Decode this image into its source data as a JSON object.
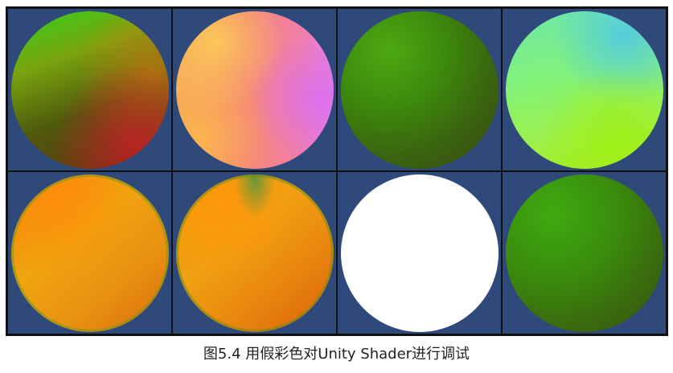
{
  "figure": {
    "caption": "图5.4 用假彩色对Unity Shader进行调试",
    "background_color": "#2f4a7a",
    "cells": [
      {
        "sphere": "false-color-sphere-1",
        "dominant_colors": [
          "#2fd21b",
          "#7aa30e",
          "#6a3010"
        ]
      },
      {
        "sphere": "false-color-sphere-2",
        "dominant_colors": [
          "#f5a55a",
          "#f5857a",
          "#e182e0"
        ]
      },
      {
        "sphere": "false-color-sphere-3",
        "dominant_colors": [
          "#4da812",
          "#3a6410"
        ]
      },
      {
        "sphere": "false-color-sphere-4",
        "dominant_colors": [
          "#6fe7a8",
          "#a8e81c",
          "#50c8e6"
        ]
      },
      {
        "sphere": "false-color-sphere-5",
        "dominant_colors": [
          "#f08a08",
          "#f0a410",
          "#d86a08"
        ]
      },
      {
        "sphere": "false-color-sphere-6",
        "dominant_colors": [
          "#f09a0c",
          "#e8840e",
          "#d8600a"
        ]
      },
      {
        "sphere": "false-color-sphere-7",
        "dominant_colors": [
          "#ffffff"
        ]
      },
      {
        "sphere": "false-color-sphere-8",
        "dominant_colors": [
          "#3faa10",
          "#3a5210"
        ]
      }
    ]
  }
}
